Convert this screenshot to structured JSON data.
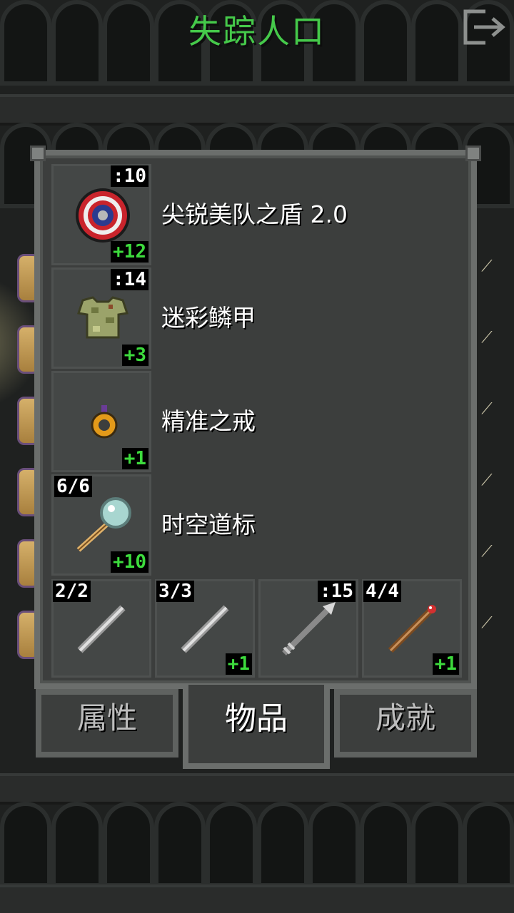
{
  "header": {
    "title": "失踪人口",
    "exit_icon": "exit-door-icon"
  },
  "items": [
    {
      "name": "尖锐美队之盾 2.0",
      "icon": "captain-shield-icon",
      "top_label": ":10",
      "bottom_label": "+12"
    },
    {
      "name": "迷彩鳞甲",
      "icon": "camo-armor-icon",
      "top_label": ":14",
      "bottom_label": "+3"
    },
    {
      "name": "精准之戒",
      "icon": "ring-icon",
      "top_label": "",
      "bottom_label": "+1"
    },
    {
      "name": "时空道标",
      "icon": "beacon-staff-icon",
      "top_label_left": "6/6",
      "bottom_label": "+10"
    }
  ],
  "quickslots": [
    {
      "icon": "wand-icon",
      "top_left": "2/2",
      "top_right": "",
      "bottom": ""
    },
    {
      "icon": "wand-icon",
      "top_left": "3/3",
      "top_right": "",
      "bottom": "+1"
    },
    {
      "icon": "throwing-spear-icon",
      "top_left": "",
      "top_right": ":15",
      "bottom": ""
    },
    {
      "icon": "fire-wand-icon",
      "top_left": "4/4",
      "top_right": "",
      "bottom": "+1"
    }
  ],
  "tabs": [
    {
      "label": "属性",
      "active": false
    },
    {
      "label": "物品",
      "active": true
    },
    {
      "label": "成就",
      "active": false
    }
  ],
  "colors": {
    "title": "#45c94a",
    "bonus": "#3ddb3d",
    "panel": "#3c3e3d"
  }
}
